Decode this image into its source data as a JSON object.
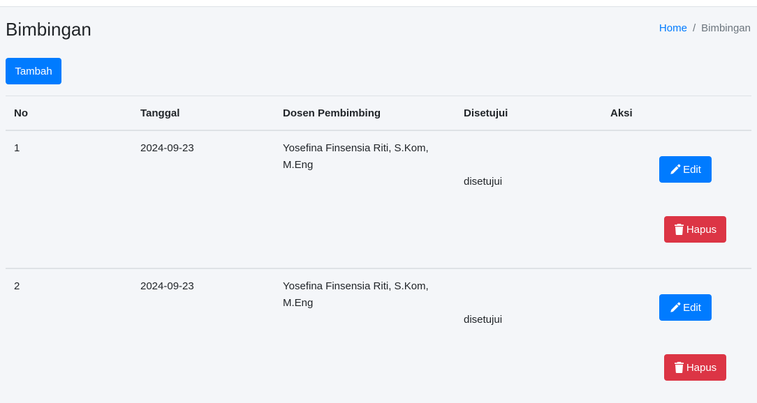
{
  "page": {
    "title": "Bimbingan"
  },
  "breadcrumb": {
    "home": "Home",
    "separator": "/",
    "current": "Bimbingan"
  },
  "toolbar": {
    "add_label": "Tambah"
  },
  "table": {
    "headers": [
      "No",
      "Tanggal",
      "Dosen Pembimbing",
      "Disetujui",
      "Aksi"
    ],
    "rows": [
      {
        "no": "1",
        "tanggal": "2024-09-23",
        "dosen_line1": "Yosefina Finsensia Riti, S.Kom,",
        "dosen_line2": "M.Eng",
        "disetujui": "disetujui",
        "edit_label": "Edit",
        "delete_label": "Hapus"
      },
      {
        "no": "2",
        "tanggal": "2024-09-23",
        "dosen_line1": "Yosefina Finsensia Riti, S.Kom,",
        "dosen_line2": "M.Eng",
        "disetujui": "disetujui",
        "edit_label": "Edit",
        "delete_label": "Hapus"
      }
    ]
  },
  "icons": {
    "edit": "pencil-icon",
    "delete": "trash-icon"
  },
  "colors": {
    "primary": "#007bff",
    "danger": "#dc3545",
    "background": "#f4f6f9"
  }
}
